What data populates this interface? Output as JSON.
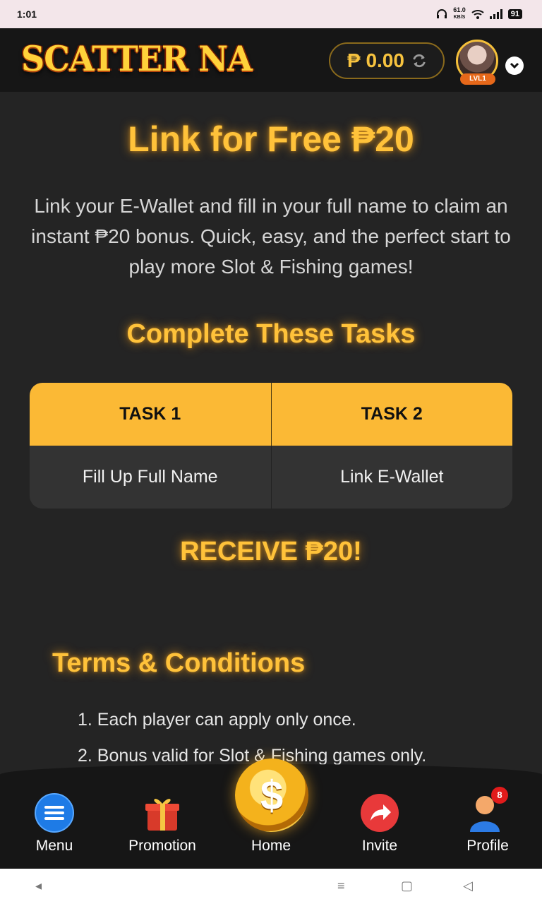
{
  "status_bar": {
    "time": "1:01",
    "net_speed": "61.0",
    "net_unit": "KB/S",
    "battery": "91"
  },
  "header": {
    "logo": "SCATTER NA",
    "balance": "₱ 0.00",
    "level": "LVL1"
  },
  "promo": {
    "title": "Link for Free ₱20",
    "description": "Link your E-Wallet and fill in your full name to claim an instant ₱20 bonus. Quick, easy, and the perfect start to play more Slot & Fishing games!",
    "tasks_heading": "Complete These Tasks",
    "tasks": [
      {
        "header": "TASK 1",
        "label": "Fill Up Full Name"
      },
      {
        "header": "TASK 2",
        "label": "Link E-Wallet"
      }
    ],
    "receive": "RECEIVE ₱20!"
  },
  "terms": {
    "title": "Terms & Conditions",
    "items": [
      "1. Each player can apply only once.",
      "2. Bonus valid for Slot & Fishing games only."
    ]
  },
  "bottom_nav": {
    "items": [
      {
        "label": "Menu",
        "icon": "menu-icon"
      },
      {
        "label": "Promotion",
        "icon": "gift-icon"
      },
      {
        "label": "Home",
        "icon": "coin-icon"
      },
      {
        "label": "Invite",
        "icon": "share-icon"
      },
      {
        "label": "Profile",
        "icon": "user-icon",
        "badge": "8"
      }
    ]
  },
  "colors": {
    "accent": "#fbb935",
    "glow": "#ffc23a",
    "background": "#242424",
    "header": "#161616"
  }
}
